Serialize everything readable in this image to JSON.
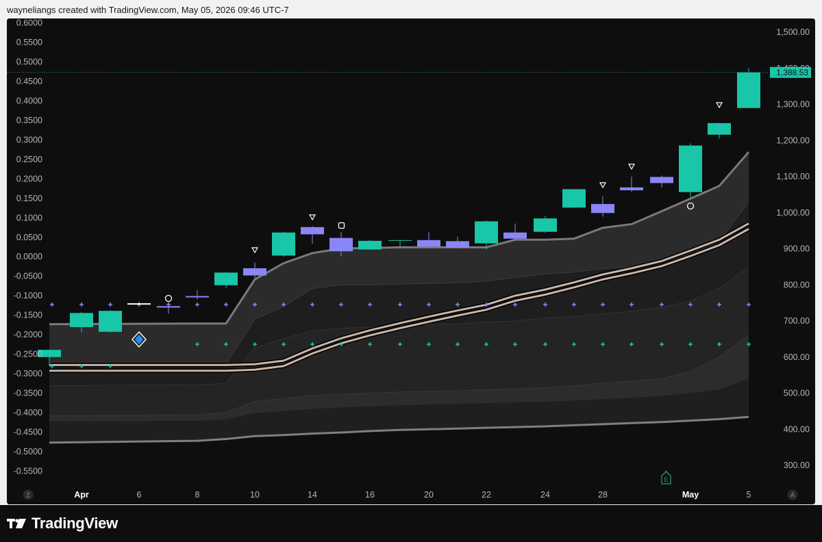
{
  "header": {
    "caption": "wayneliangs created with TradingView.com, May 05, 2026 09:46 UTC-7"
  },
  "brand": {
    "name": "TradingView"
  },
  "colors": {
    "background": "#0e0e0e",
    "bull": "#19c6a8",
    "bear": "#8a86f5",
    "axis_text": "#b2b5be",
    "price_label_bg": "#19c6a8",
    "band_fill": "#2a2a2a",
    "ma_line": "#c9b4a8"
  },
  "left_axis": {
    "ticks": [
      "0.6000",
      "0.5500",
      "0.5000",
      "0.4500",
      "0.4000",
      "0.3500",
      "0.3000",
      "0.2500",
      "0.2000",
      "0.1500",
      "0.1000",
      "0.0500",
      "0.0000",
      "-0.0500",
      "-0.1000",
      "-0.1500",
      "-0.2000",
      "-0.2500",
      "-0.3000",
      "-0.3500",
      "-0.4000",
      "-0.4500",
      "-0.5000",
      "-0.5500"
    ]
  },
  "right_axis": {
    "ticks": [
      "1,500.00",
      "1,400.00",
      "1,300.00",
      "1,200.00",
      "1,100.00",
      "1,000.00",
      "900.00",
      "800.00",
      "700.00",
      "600.00",
      "500.00",
      "400.00",
      "300.00"
    ],
    "last_price_label": "1,388.53"
  },
  "x_axis": {
    "labels": [
      {
        "text": "Apr",
        "bold": true
      },
      {
        "text": "6",
        "bold": false
      },
      {
        "text": "8",
        "bold": false
      },
      {
        "text": "10",
        "bold": false
      },
      {
        "text": "14",
        "bold": false
      },
      {
        "text": "16",
        "bold": false
      },
      {
        "text": "20",
        "bold": false
      },
      {
        "text": "22",
        "bold": false
      },
      {
        "text": "24",
        "bold": false
      },
      {
        "text": "28",
        "bold": false
      },
      {
        "text": "May",
        "bold": true
      },
      {
        "text": "5",
        "bold": false
      }
    ],
    "corner_left": "Z",
    "corner_right": "A"
  },
  "earnings_marker": "E",
  "chart_data": {
    "type": "candlestick",
    "x": [
      "Apr 2",
      "Apr 3",
      "Apr 6",
      "Apr 7",
      "Apr 8",
      "Apr 9",
      "Apr 10",
      "Apr 13",
      "Apr 14",
      "Apr 15",
      "Apr 16",
      "Apr 17",
      "Apr 20",
      "Apr 21",
      "Apr 22",
      "Apr 23",
      "Apr 24",
      "Apr 27",
      "Apr 28",
      "Apr 29",
      "Apr 30",
      "May 1",
      "May 4",
      "May 5"
    ],
    "candles": [
      {
        "o": 600,
        "h": 620,
        "l": 575,
        "c": 620,
        "dir": "up"
      },
      {
        "o": 680,
        "h": 722,
        "l": 665,
        "c": 718,
        "dir": "up"
      },
      {
        "o": 668,
        "h": 728,
        "l": 668,
        "c": 728,
        "dir": "up"
      },
      {
        "o": 749,
        "h": 752,
        "l": 746,
        "c": 749,
        "dir": "flat"
      },
      {
        "o": 742,
        "h": 748,
        "l": 725,
        "c": 737,
        "dir": "down"
      },
      {
        "o": 768,
        "h": 786,
        "l": 760,
        "c": 768,
        "dir": "down"
      },
      {
        "o": 798,
        "h": 835,
        "l": 792,
        "c": 833,
        "dir": "up"
      },
      {
        "o": 847,
        "h": 861,
        "l": 829,
        "c": 826,
        "dir": "down"
      },
      {
        "o": 880,
        "h": 945,
        "l": 880,
        "c": 944,
        "dir": "up"
      },
      {
        "o": 960,
        "h": 962,
        "l": 914,
        "c": 940,
        "dir": "down"
      },
      {
        "o": 930,
        "h": 946,
        "l": 879,
        "c": 895,
        "dir": "down"
      },
      {
        "o": 900,
        "h": 920,
        "l": 900,
        "c": 921,
        "dir": "up"
      },
      {
        "o": 923,
        "h": 923,
        "l": 890,
        "c": 923,
        "dir": "flat"
      },
      {
        "o": 924,
        "h": 946,
        "l": 912,
        "c": 907,
        "dir": "down"
      },
      {
        "o": 921,
        "h": 935,
        "l": 902,
        "c": 905,
        "dir": "down"
      },
      {
        "o": 915,
        "h": 980,
        "l": 898,
        "c": 975,
        "dir": "up"
      },
      {
        "o": 945,
        "h": 972,
        "l": 930,
        "c": 929,
        "dir": "down"
      },
      {
        "o": 950,
        "h": 990,
        "l": 943,
        "c": 984,
        "dir": "up"
      },
      {
        "o": 1013,
        "h": 1065,
        "l": 1013,
        "c": 1065,
        "dir": "up"
      },
      {
        "o": 1024,
        "h": 1044,
        "l": 991,
        "c": 1000,
        "dir": "down"
      },
      {
        "o": 1069,
        "h": 1099,
        "l": 1045,
        "c": 1062,
        "dir": "down"
      },
      {
        "o": 1099,
        "h": 1103,
        "l": 1070,
        "c": 1082,
        "dir": "down"
      },
      {
        "o": 1058,
        "h": 1193,
        "l": 1042,
        "c": 1185,
        "dir": "up"
      },
      {
        "o": 1216,
        "h": 1247,
        "l": 1206,
        "c": 1248,
        "dir": "up"
      },
      {
        "o": 1290,
        "h": 1400,
        "l": 1290,
        "c": 1388.53,
        "dir": "up"
      }
    ],
    "last_price": 1388.53,
    "ylim_right": [
      250,
      1540
    ],
    "ylim_left": [
      -0.6035,
      0.6106
    ]
  }
}
